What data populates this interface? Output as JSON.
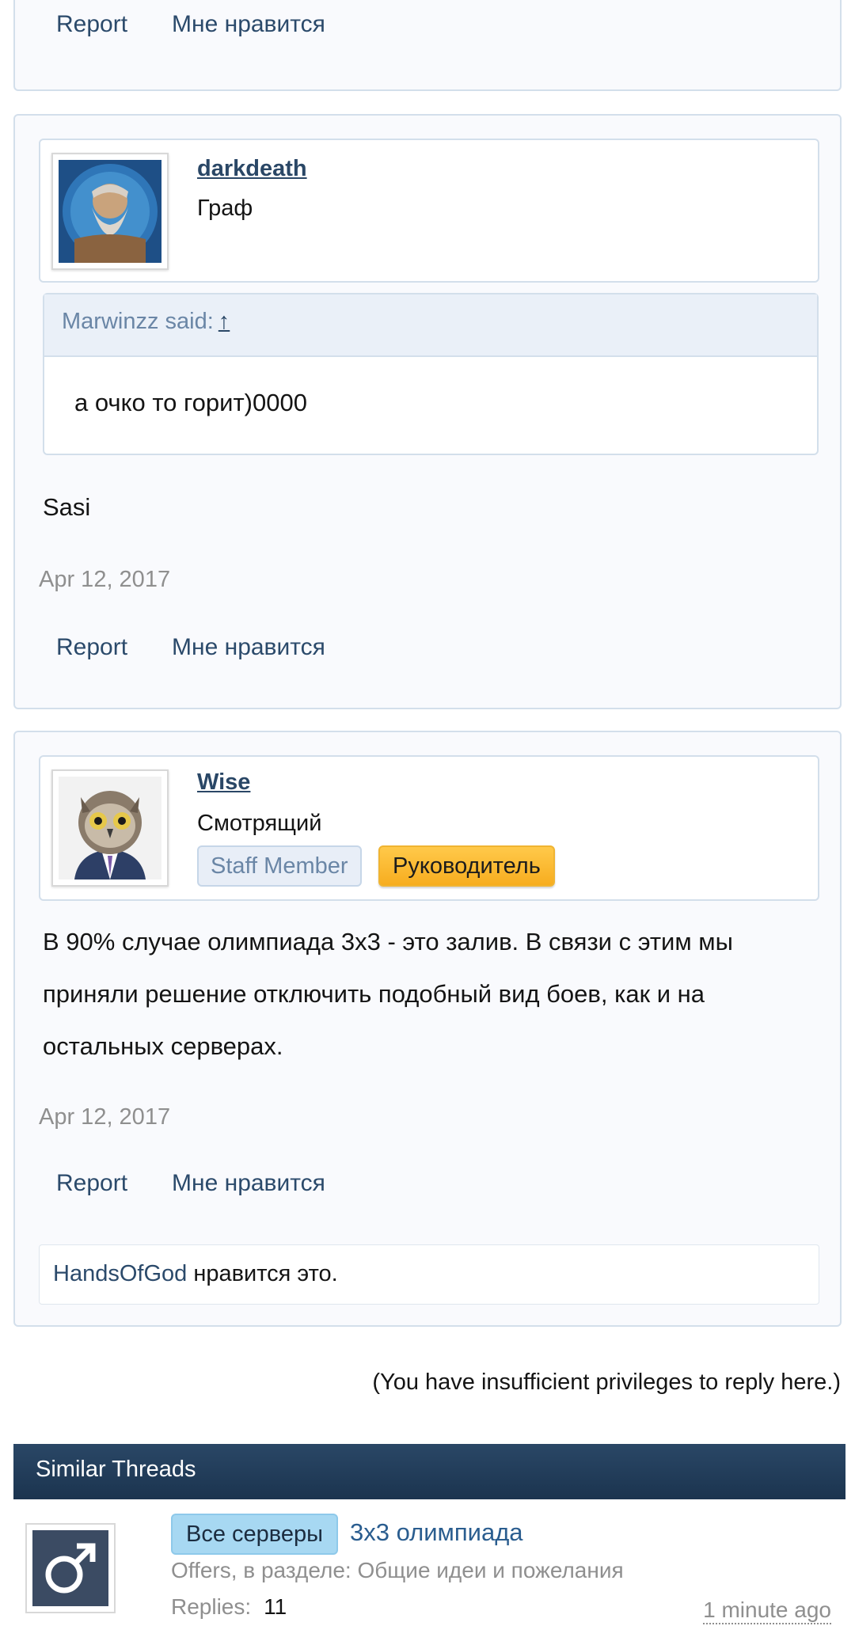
{
  "top_post": {
    "report_label": "Report",
    "like_label": "Мне нравится"
  },
  "post1": {
    "username": "darkdeath",
    "user_title": "Граф",
    "quote": {
      "author": "Marwinzz said:",
      "jump": "↑",
      "text": "а очко то горит)0000"
    },
    "message": "Sasi",
    "date": "Apr 12, 2017",
    "report_label": "Report",
    "like_label": "Мне нравится"
  },
  "post2": {
    "username": "Wise",
    "user_title": "Смотрящий",
    "badges": {
      "staff": "Staff Member",
      "lead": "Руководитель"
    },
    "message_lines": [
      "В 90% случае олимпиада 3х3 - это залив. В связи с этим мы",
      "приняли решение отключить подобный вид боев, как и на",
      "остальных серверах."
    ],
    "date": "Apr 12, 2017",
    "report_label": "Report",
    "like_label": "Мне нравится",
    "likes": {
      "user": "HandsOfGod",
      "suffix": " нравится это."
    }
  },
  "reply_notice": "(You have insufficient privileges to reply here.)",
  "similar_threads": {
    "header": "Similar Threads",
    "items": [
      {
        "icon": "male-symbol-icon",
        "prefix": "Все серверы",
        "title": "3х3 олимпиада",
        "meta": "Offers, в разделе: Общие идеи и пожелания",
        "replies_label": "Replies:",
        "replies_count": "11",
        "time": "1 minute ago"
      }
    ]
  },
  "colors": {
    "link": "#2a4766",
    "post_bg": "#f9fafd",
    "border": "#d3dfeb",
    "badge_lead": "#f7ad1f",
    "prefix_bg": "#a7d8f2",
    "header_bar": "#1b344f"
  }
}
